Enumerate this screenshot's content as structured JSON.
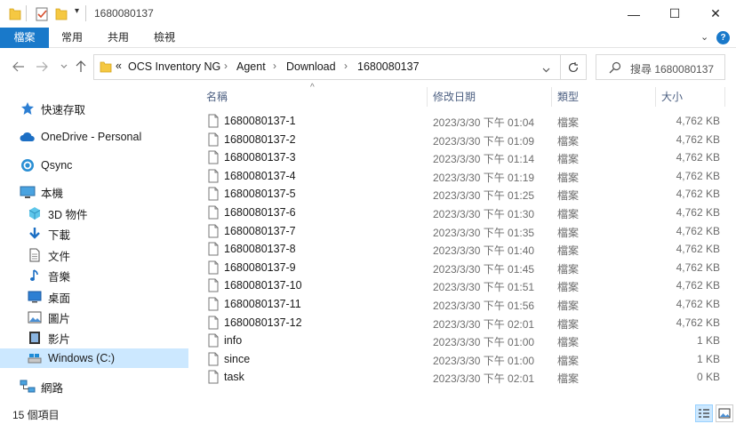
{
  "window": {
    "title": "1680080137",
    "minimize": "—",
    "maximize": "☐",
    "close": "✕"
  },
  "ribbon": {
    "tabs": [
      "檔案",
      "常用",
      "共用",
      "檢視"
    ],
    "active_tab": "檔案",
    "accent": "#1979ca"
  },
  "address": {
    "overflow": "«",
    "breadcrumb": [
      "OCS Inventory NG",
      "Agent",
      "Download",
      "1680080137"
    ],
    "search_placeholder": "搜尋 1680080137"
  },
  "nav": {
    "items": [
      {
        "label": "快速存取",
        "icon": "star-icon"
      },
      {
        "label": "OneDrive - Personal",
        "icon": "cloud-icon"
      },
      {
        "label": "Qsync",
        "icon": "qsync-icon"
      },
      {
        "label": "本機",
        "icon": "computer-icon"
      },
      {
        "label": "3D 物件",
        "icon": "cube-icon"
      },
      {
        "label": "下載",
        "icon": "download-icon"
      },
      {
        "label": "文件",
        "icon": "document-icon"
      },
      {
        "label": "音樂",
        "icon": "music-icon"
      },
      {
        "label": "桌面",
        "icon": "desktop-icon"
      },
      {
        "label": "圖片",
        "icon": "pictures-icon"
      },
      {
        "label": "影片",
        "icon": "video-icon"
      },
      {
        "label": "Windows (C:)",
        "icon": "drive-icon"
      },
      {
        "label": "網路",
        "icon": "network-icon"
      }
    ],
    "selected": "Windows (C:)"
  },
  "columns": {
    "name": "名稱",
    "date": "修改日期",
    "type": "類型",
    "size": "大小"
  },
  "files": [
    {
      "name": "1680080137-1",
      "date": "2023/3/30 下午 01:04",
      "type": "檔案",
      "size": "4,762 KB"
    },
    {
      "name": "1680080137-2",
      "date": "2023/3/30 下午 01:09",
      "type": "檔案",
      "size": "4,762 KB"
    },
    {
      "name": "1680080137-3",
      "date": "2023/3/30 下午 01:14",
      "type": "檔案",
      "size": "4,762 KB"
    },
    {
      "name": "1680080137-4",
      "date": "2023/3/30 下午 01:19",
      "type": "檔案",
      "size": "4,762 KB"
    },
    {
      "name": "1680080137-5",
      "date": "2023/3/30 下午 01:25",
      "type": "檔案",
      "size": "4,762 KB"
    },
    {
      "name": "1680080137-6",
      "date": "2023/3/30 下午 01:30",
      "type": "檔案",
      "size": "4,762 KB"
    },
    {
      "name": "1680080137-7",
      "date": "2023/3/30 下午 01:35",
      "type": "檔案",
      "size": "4,762 KB"
    },
    {
      "name": "1680080137-8",
      "date": "2023/3/30 下午 01:40",
      "type": "檔案",
      "size": "4,762 KB"
    },
    {
      "name": "1680080137-9",
      "date": "2023/3/30 下午 01:45",
      "type": "檔案",
      "size": "4,762 KB"
    },
    {
      "name": "1680080137-10",
      "date": "2023/3/30 下午 01:51",
      "type": "檔案",
      "size": "4,762 KB"
    },
    {
      "name": "1680080137-11",
      "date": "2023/3/30 下午 01:56",
      "type": "檔案",
      "size": "4,762 KB"
    },
    {
      "name": "1680080137-12",
      "date": "2023/3/30 下午 02:01",
      "type": "檔案",
      "size": "4,762 KB"
    },
    {
      "name": "info",
      "date": "2023/3/30 下午 01:00",
      "type": "檔案",
      "size": "1 KB"
    },
    {
      "name": "since",
      "date": "2023/3/30 下午 01:00",
      "type": "檔案",
      "size": "1 KB"
    },
    {
      "name": "task",
      "date": "2023/3/30 下午 02:01",
      "type": "檔案",
      "size": "0 KB"
    }
  ],
  "status": {
    "count": "15 個項目"
  }
}
